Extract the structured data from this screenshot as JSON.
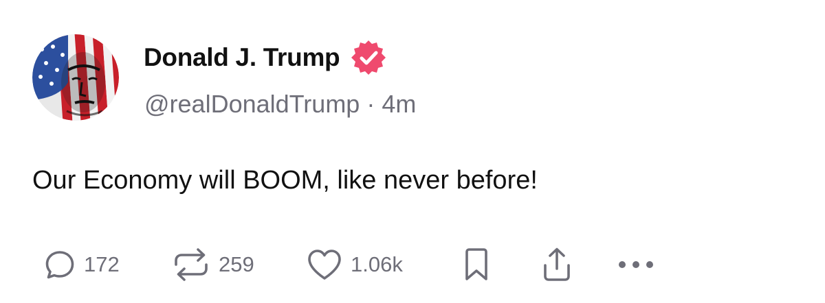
{
  "author": {
    "display_name": "Donald J. Trump",
    "handle": "@realDonaldTrump",
    "separator": "·",
    "timestamp": "4m",
    "verified_icon": "verified-badge-icon"
  },
  "post": {
    "text": "Our Economy will BOOM, like never before!"
  },
  "actions": {
    "replies": "172",
    "reposts": "259",
    "likes": "1.06k",
    "reply_icon": "comment-icon",
    "repost_icon": "repost-icon",
    "like_icon": "heart-icon",
    "bookmark_icon": "bookmark-icon",
    "share_icon": "share-icon",
    "more_icon": "more-icon"
  },
  "colors": {
    "verified": "#ef4a6e",
    "text": "#111111",
    "secondary": "#6e6e78"
  }
}
